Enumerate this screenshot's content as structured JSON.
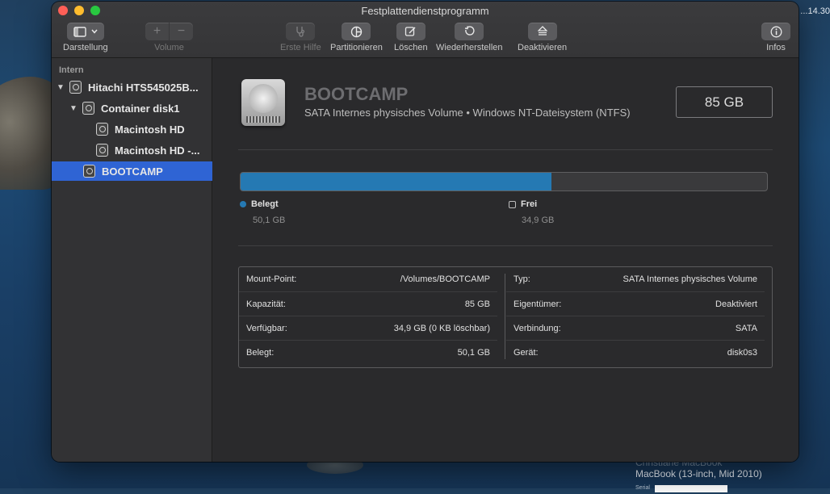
{
  "desktop": {
    "top_right_text": "...14.30",
    "bottom_line_faded": "Christiane MacBook",
    "bottom_line": "MacBook (13-inch, Mid 2010)",
    "serial_label": "Serial"
  },
  "window": {
    "title": "Festplattendienstprogramm"
  },
  "toolbar": {
    "view_label": "Darstellung",
    "volume_label": "Volume",
    "first_aid_label": "Erste Hilfe",
    "partition_label": "Partitionieren",
    "erase_label": "Löschen",
    "restore_label": "Wiederherstellen",
    "unmount_label": "Deaktivieren",
    "info_label": "Infos",
    "add_glyph": "+",
    "remove_glyph": "−"
  },
  "sidebar": {
    "section_label": "Intern",
    "items": [
      {
        "label": "Hitachi HTS545025B...",
        "level": 0,
        "disclosure": "▼"
      },
      {
        "label": "Container disk1",
        "level": 1,
        "disclosure": "▼"
      },
      {
        "label": "Macintosh HD",
        "level": 2,
        "disclosure": ""
      },
      {
        "label": "Macintosh HD -...",
        "level": 2,
        "disclosure": ""
      },
      {
        "label": "BOOTCAMP",
        "level": 1,
        "disclosure": "",
        "selected": true
      }
    ]
  },
  "volume": {
    "name": "BOOTCAMP",
    "description": "SATA Internes physisches Volume • Windows NT-Dateisystem (NTFS)",
    "size": "85 GB",
    "used_fraction": 0.59,
    "used_color": "#2579b3",
    "used_label": "Belegt",
    "used_value": "50,1 GB",
    "free_label": "Frei",
    "free_value": "34,9 GB"
  },
  "info_table": {
    "left": [
      {
        "key": "Mount-Point:",
        "value": "/Volumes/BOOTCAMP"
      },
      {
        "key": "Kapazität:",
        "value": "85 GB"
      },
      {
        "key": "Verfügbar:",
        "value": "34,9 GB (0 KB löschbar)"
      },
      {
        "key": "Belegt:",
        "value": "50,1 GB"
      }
    ],
    "right": [
      {
        "key": "Typ:",
        "value": "SATA Internes physisches Volume"
      },
      {
        "key": "Eigentümer:",
        "value": "Deaktiviert"
      },
      {
        "key": "Verbindung:",
        "value": "SATA"
      },
      {
        "key": "Gerät:",
        "value": "disk0s3"
      }
    ]
  }
}
